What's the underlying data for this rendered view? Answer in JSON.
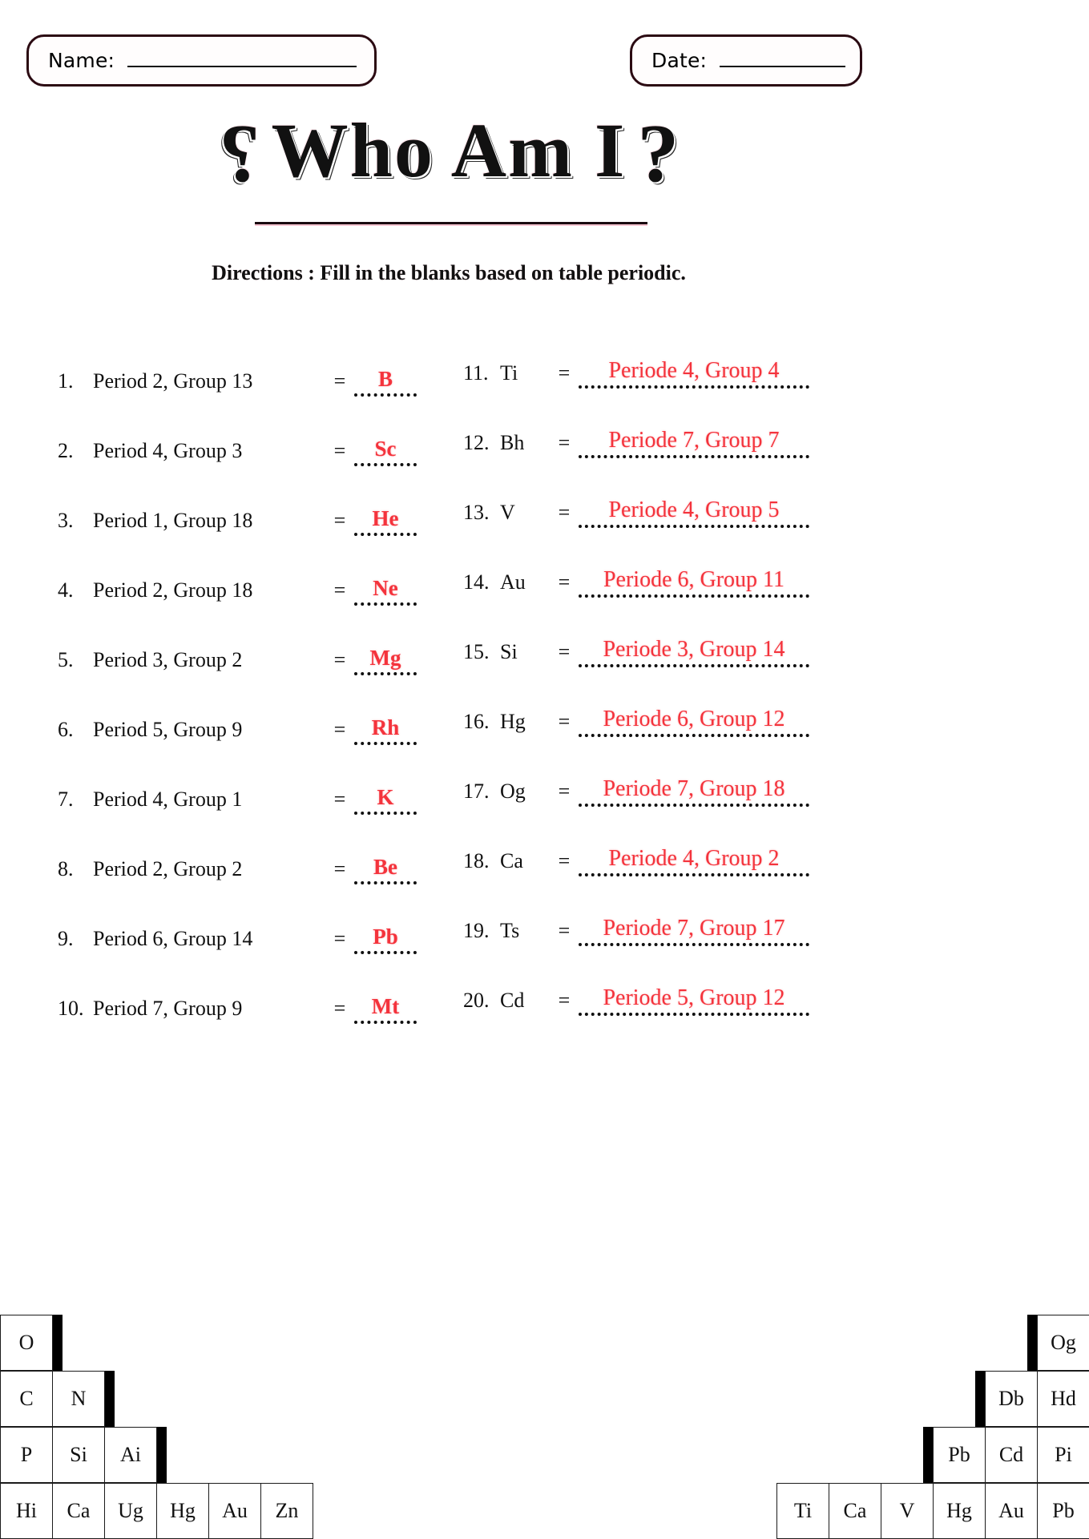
{
  "header": {
    "name_label": "Name:",
    "date_label": "Date:"
  },
  "title": {
    "text": "Who Am I",
    "left_mark": "?",
    "right_mark": "?"
  },
  "directions": "Directions : Fill in the blanks based on table periodic.",
  "questions_left": [
    {
      "num": "1.",
      "prompt": "Period 2, Group 13",
      "eq": "=",
      "answer": "B"
    },
    {
      "num": "2.",
      "prompt": "Period 4, Group 3",
      "eq": "=",
      "answer": "Sc"
    },
    {
      "num": "3.",
      "prompt": "Period 1, Group 18",
      "eq": "=",
      "answer": "He"
    },
    {
      "num": "4.",
      "prompt": "Period 2, Group 18",
      "eq": "=",
      "answer": "Ne"
    },
    {
      "num": "5.",
      "prompt": "Period 3, Group 2",
      "eq": "=",
      "answer": "Mg"
    },
    {
      "num": "6.",
      "prompt": "Period 5, Group 9",
      "eq": "=",
      "answer": "Rh"
    },
    {
      "num": "7.",
      "prompt": "Period 4, Group 1",
      "eq": "=",
      "answer": "K"
    },
    {
      "num": "8.",
      "prompt": "Period 2, Group 2",
      "eq": "=",
      "answer": "Be"
    },
    {
      "num": "9.",
      "prompt": "Period 6, Group 14",
      "eq": "=",
      "answer": "Pb"
    },
    {
      "num": "10.",
      "prompt": "Period 7, Group 9",
      "eq": "=",
      "answer": "Mt"
    }
  ],
  "questions_right": [
    {
      "num": "11.",
      "prompt": "Ti",
      "eq": "=",
      "answer": "Periode 4, Group 4"
    },
    {
      "num": "12.",
      "prompt": "Bh",
      "eq": "=",
      "answer": "Periode 7, Group 7"
    },
    {
      "num": "13.",
      "prompt": "V",
      "eq": "=",
      "answer": "Periode 4, Group 5"
    },
    {
      "num": "14.",
      "prompt": "Au",
      "eq": "=",
      "answer": "Periode 6, Group 11"
    },
    {
      "num": "15.",
      "prompt": "Si",
      "eq": "=",
      "answer": "Periode 3, Group 14"
    },
    {
      "num": "16.",
      "prompt": "Hg",
      "eq": "=",
      "answer": "Periode 6, Group 12"
    },
    {
      "num": "17.",
      "prompt": "Og",
      "eq": "=",
      "answer": "Periode 7, Group 18"
    },
    {
      "num": "18.",
      "prompt": "Ca",
      "eq": "=",
      "answer": "Periode 4, Group 2"
    },
    {
      "num": "19.",
      "prompt": "Ts",
      "eq": "=",
      "answer": "Periode 7, Group 17"
    },
    {
      "num": "20.",
      "prompt": "Cd",
      "eq": "=",
      "answer": "Periode 5, Group 12"
    }
  ],
  "stair_left": [
    [
      "O"
    ],
    [
      "C",
      "N"
    ],
    [
      "P",
      "Si",
      "Ai"
    ],
    [
      "Hi",
      "Ca",
      "Ug",
      "Hg",
      "Au",
      "Zn"
    ]
  ],
  "stair_right": [
    [
      "Og"
    ],
    [
      "Db",
      "Hd"
    ],
    [
      "Pb",
      "Cd",
      "Pi"
    ],
    [
      "Ti",
      "Ca",
      "V",
      "Hg",
      "Au",
      "Pb"
    ]
  ],
  "colors": {
    "answer_red": "#f4333c",
    "box_border": "#2b0a12",
    "ink": "#111111"
  }
}
